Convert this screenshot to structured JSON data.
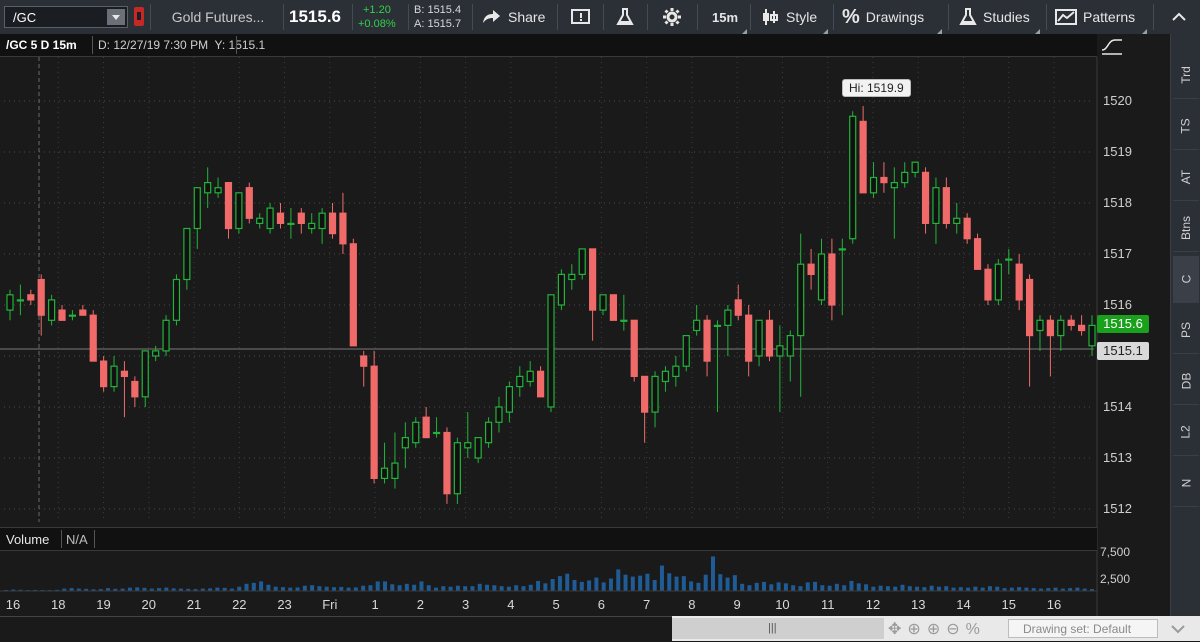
{
  "toolbar": {
    "symbol": "/GC",
    "description": "Gold Futures...",
    "last": "1515.6",
    "change": "+1.20",
    "change_pct": "+0.08%",
    "bid": "B: 1515.4",
    "ask": "A: 1515.7",
    "share_label": "Share",
    "timeframe": "15m",
    "style_label": "Style",
    "drawings_label": "Drawings",
    "studies_label": "Studies",
    "patterns_label": "Patterns"
  },
  "chart_header": {
    "symbol_period": "/GC 5 D 15m",
    "cursor_info": "D: 12/27/19 7:30 PM  Y: 1515.1"
  },
  "hi_bubble": "Hi: 1519.9",
  "price_badges": {
    "last": "1515.6",
    "cursor": "1515.1"
  },
  "volume_panel": {
    "label": "Volume",
    "value": "N/A",
    "ticks": [
      "7,500",
      "2,500"
    ]
  },
  "side_tabs": [
    "Trd",
    "TS",
    "AT",
    "Btns",
    "C",
    "PS",
    "DB",
    "L2",
    "N"
  ],
  "status": {
    "drawing_set": "Drawing set: Default"
  },
  "colors": {
    "up": "#22b33a",
    "down": "#f06a6a",
    "volume": "#1f5b94",
    "last_badge": "#1aa31a",
    "background": "#1a1a1a"
  },
  "chart_data": {
    "type": "candlestick",
    "y_ticks": [
      1512,
      1513,
      1514,
      1515,
      1516,
      1517,
      1518,
      1519,
      1520
    ],
    "ylim": [
      1511.8,
      1520.9
    ],
    "x_labels": [
      "16",
      "18",
      "19",
      "20",
      "21",
      "22",
      "23",
      "Fri",
      "1",
      "2",
      "3",
      "4",
      "5",
      "6",
      "7",
      "8",
      "9",
      "10",
      "11",
      "12",
      "13",
      "14",
      "15",
      "16"
    ],
    "candles": [
      {
        "o": 1515.9,
        "h": 1516.3,
        "l": 1515.7,
        "c": 1516.2
      },
      {
        "o": 1516.1,
        "h": 1516.4,
        "l": 1515.8,
        "c": 1516.1
      },
      {
        "o": 1516.2,
        "h": 1516.3,
        "l": 1516.0,
        "c": 1516.1
      },
      {
        "o": 1516.5,
        "h": 1516.6,
        "l": 1515.4,
        "c": 1515.8
      },
      {
        "o": 1515.7,
        "h": 1516.2,
        "l": 1515.6,
        "c": 1516.1
      },
      {
        "o": 1515.9,
        "h": 1516.0,
        "l": 1515.7,
        "c": 1515.7
      },
      {
        "o": 1515.8,
        "h": 1515.9,
        "l": 1515.7,
        "c": 1515.8
      },
      {
        "o": 1515.9,
        "h": 1516.0,
        "l": 1515.8,
        "c": 1515.8
      },
      {
        "o": 1515.8,
        "h": 1515.9,
        "l": 1514.9,
        "c": 1514.9
      },
      {
        "o": 1514.9,
        "h": 1515.0,
        "l": 1514.3,
        "c": 1514.4
      },
      {
        "o": 1514.4,
        "h": 1515.0,
        "l": 1514.3,
        "c": 1514.8
      },
      {
        "o": 1514.7,
        "h": 1514.9,
        "l": 1513.8,
        "c": 1514.6
      },
      {
        "o": 1514.5,
        "h": 1514.6,
        "l": 1514.0,
        "c": 1514.2
      },
      {
        "o": 1514.2,
        "h": 1515.1,
        "l": 1514.0,
        "c": 1515.1
      },
      {
        "o": 1515.0,
        "h": 1515.2,
        "l": 1514.9,
        "c": 1515.1
      },
      {
        "o": 1515.1,
        "h": 1515.8,
        "l": 1515.0,
        "c": 1515.7
      },
      {
        "o": 1515.7,
        "h": 1516.6,
        "l": 1515.6,
        "c": 1516.5
      },
      {
        "o": 1516.5,
        "h": 1517.5,
        "l": 1516.3,
        "c": 1517.5
      },
      {
        "o": 1517.5,
        "h": 1518.3,
        "l": 1517.1,
        "c": 1518.3
      },
      {
        "o": 1518.2,
        "h": 1518.7,
        "l": 1517.9,
        "c": 1518.4
      },
      {
        "o": 1518.2,
        "h": 1518.5,
        "l": 1518.1,
        "c": 1518.3
      },
      {
        "o": 1518.4,
        "h": 1518.4,
        "l": 1517.3,
        "c": 1517.5
      },
      {
        "o": 1517.5,
        "h": 1518.2,
        "l": 1517.4,
        "c": 1518.2
      },
      {
        "o": 1518.3,
        "h": 1518.4,
        "l": 1517.6,
        "c": 1517.7
      },
      {
        "o": 1517.6,
        "h": 1517.8,
        "l": 1517.5,
        "c": 1517.7
      },
      {
        "o": 1517.5,
        "h": 1518.0,
        "l": 1517.4,
        "c": 1517.9
      },
      {
        "o": 1517.8,
        "h": 1518.0,
        "l": 1517.5,
        "c": 1517.6
      },
      {
        "o": 1517.6,
        "h": 1517.9,
        "l": 1517.3,
        "c": 1517.6
      },
      {
        "o": 1517.8,
        "h": 1517.9,
        "l": 1517.4,
        "c": 1517.6
      },
      {
        "o": 1517.5,
        "h": 1517.8,
        "l": 1517.4,
        "c": 1517.6
      },
      {
        "o": 1517.5,
        "h": 1517.9,
        "l": 1517.2,
        "c": 1517.8
      },
      {
        "o": 1517.8,
        "h": 1518.0,
        "l": 1517.3,
        "c": 1517.4
      },
      {
        "o": 1517.8,
        "h": 1518.2,
        "l": 1517.0,
        "c": 1517.2
      },
      {
        "o": 1517.2,
        "h": 1517.3,
        "l": 1515.2,
        "c": 1515.2
      },
      {
        "o": 1515.0,
        "h": 1515.1,
        "l": 1514.4,
        "c": 1514.8
      },
      {
        "o": 1514.8,
        "h": 1515.1,
        "l": 1512.5,
        "c": 1512.6
      },
      {
        "o": 1512.6,
        "h": 1513.3,
        "l": 1512.5,
        "c": 1512.8
      },
      {
        "o": 1512.6,
        "h": 1513.5,
        "l": 1512.4,
        "c": 1512.9
      },
      {
        "o": 1513.2,
        "h": 1513.7,
        "l": 1512.8,
        "c": 1513.4
      },
      {
        "o": 1513.3,
        "h": 1513.8,
        "l": 1513.2,
        "c": 1513.7
      },
      {
        "o": 1513.8,
        "h": 1514.0,
        "l": 1513.6,
        "c": 1513.4
      },
      {
        "o": 1513.5,
        "h": 1513.8,
        "l": 1513.4,
        "c": 1513.5
      },
      {
        "o": 1513.5,
        "h": 1513.6,
        "l": 1512.1,
        "c": 1512.3
      },
      {
        "o": 1512.3,
        "h": 1513.4,
        "l": 1512.1,
        "c": 1513.3
      },
      {
        "o": 1513.2,
        "h": 1513.9,
        "l": 1513.0,
        "c": 1513.3
      },
      {
        "o": 1513.0,
        "h": 1513.4,
        "l": 1512.9,
        "c": 1513.4
      },
      {
        "o": 1513.3,
        "h": 1513.8,
        "l": 1513.2,
        "c": 1513.7
      },
      {
        "o": 1513.7,
        "h": 1514.2,
        "l": 1513.5,
        "c": 1514.0
      },
      {
        "o": 1513.9,
        "h": 1514.5,
        "l": 1513.7,
        "c": 1514.4
      },
      {
        "o": 1514.4,
        "h": 1514.8,
        "l": 1514.2,
        "c": 1514.6
      },
      {
        "o": 1514.5,
        "h": 1514.9,
        "l": 1514.4,
        "c": 1514.7
      },
      {
        "o": 1514.7,
        "h": 1514.8,
        "l": 1514.2,
        "c": 1514.2
      },
      {
        "o": 1514.0,
        "h": 1516.2,
        "l": 1513.9,
        "c": 1516.2
      },
      {
        "o": 1516.0,
        "h": 1516.7,
        "l": 1515.9,
        "c": 1516.6
      },
      {
        "o": 1516.5,
        "h": 1516.8,
        "l": 1516.3,
        "c": 1516.6
      },
      {
        "o": 1516.6,
        "h": 1517.1,
        "l": 1516.5,
        "c": 1517.1
      },
      {
        "o": 1517.1,
        "h": 1517.1,
        "l": 1515.3,
        "c": 1515.9
      },
      {
        "o": 1515.9,
        "h": 1516.2,
        "l": 1515.8,
        "c": 1516.2
      },
      {
        "o": 1516.2,
        "h": 1516.2,
        "l": 1515.7,
        "c": 1515.7
      },
      {
        "o": 1515.7,
        "h": 1516.2,
        "l": 1515.5,
        "c": 1515.7
      },
      {
        "o": 1515.7,
        "h": 1515.7,
        "l": 1514.5,
        "c": 1514.6
      },
      {
        "o": 1514.6,
        "h": 1514.6,
        "l": 1513.3,
        "c": 1513.9
      },
      {
        "o": 1513.9,
        "h": 1514.7,
        "l": 1513.6,
        "c": 1514.6
      },
      {
        "o": 1514.5,
        "h": 1514.8,
        "l": 1514.3,
        "c": 1514.7
      },
      {
        "o": 1514.6,
        "h": 1515.0,
        "l": 1514.4,
        "c": 1514.8
      },
      {
        "o": 1514.8,
        "h": 1515.4,
        "l": 1514.7,
        "c": 1515.4
      },
      {
        "o": 1515.5,
        "h": 1516.0,
        "l": 1515.4,
        "c": 1515.7
      },
      {
        "o": 1515.7,
        "h": 1515.8,
        "l": 1514.6,
        "c": 1514.9
      },
      {
        "o": 1515.6,
        "h": 1515.7,
        "l": 1513.9,
        "c": 1515.6
      },
      {
        "o": 1515.6,
        "h": 1516.0,
        "l": 1515.0,
        "c": 1515.9
      },
      {
        "o": 1516.1,
        "h": 1516.4,
        "l": 1515.7,
        "c": 1515.8
      },
      {
        "o": 1515.8,
        "h": 1516.0,
        "l": 1514.6,
        "c": 1514.9
      },
      {
        "o": 1515.0,
        "h": 1515.6,
        "l": 1514.8,
        "c": 1515.7
      },
      {
        "o": 1515.7,
        "h": 1515.9,
        "l": 1514.9,
        "c": 1515.0
      },
      {
        "o": 1515.0,
        "h": 1515.6,
        "l": 1513.9,
        "c": 1515.2
      },
      {
        "o": 1515.0,
        "h": 1515.5,
        "l": 1514.5,
        "c": 1515.4
      },
      {
        "o": 1515.4,
        "h": 1517.4,
        "l": 1514.2,
        "c": 1516.8
      },
      {
        "o": 1516.8,
        "h": 1517.1,
        "l": 1516.3,
        "c": 1516.6
      },
      {
        "o": 1516.1,
        "h": 1517.3,
        "l": 1516.0,
        "c": 1517.0
      },
      {
        "o": 1517.0,
        "h": 1517.3,
        "l": 1515.7,
        "c": 1516.0
      },
      {
        "o": 1517.1,
        "h": 1517.3,
        "l": 1515.8,
        "c": 1517.1
      },
      {
        "o": 1517.3,
        "h": 1519.8,
        "l": 1517.2,
        "c": 1519.7
      },
      {
        "o": 1519.6,
        "h": 1519.9,
        "l": 1518.2,
        "c": 1518.2
      },
      {
        "o": 1518.2,
        "h": 1518.8,
        "l": 1518.1,
        "c": 1518.5
      },
      {
        "o": 1518.5,
        "h": 1518.8,
        "l": 1518.2,
        "c": 1518.4
      },
      {
        "o": 1518.3,
        "h": 1518.7,
        "l": 1517.3,
        "c": 1518.4
      },
      {
        "o": 1518.4,
        "h": 1518.8,
        "l": 1518.3,
        "c": 1518.6
      },
      {
        "o": 1518.6,
        "h": 1518.8,
        "l": 1518.5,
        "c": 1518.8
      },
      {
        "o": 1518.6,
        "h": 1518.7,
        "l": 1517.4,
        "c": 1517.6
      },
      {
        "o": 1517.6,
        "h": 1518.5,
        "l": 1517.2,
        "c": 1518.3
      },
      {
        "o": 1518.3,
        "h": 1518.5,
        "l": 1517.5,
        "c": 1517.6
      },
      {
        "o": 1517.6,
        "h": 1518.0,
        "l": 1517.4,
        "c": 1517.7
      },
      {
        "o": 1517.7,
        "h": 1517.8,
        "l": 1517.2,
        "c": 1517.3
      },
      {
        "o": 1517.3,
        "h": 1517.4,
        "l": 1516.7,
        "c": 1516.7
      },
      {
        "o": 1516.7,
        "h": 1516.8,
        "l": 1516.0,
        "c": 1516.1
      },
      {
        "o": 1516.1,
        "h": 1516.9,
        "l": 1516.0,
        "c": 1516.8
      },
      {
        "o": 1516.9,
        "h": 1517.1,
        "l": 1516.6,
        "c": 1516.9
      },
      {
        "o": 1516.8,
        "h": 1517.0,
        "l": 1515.9,
        "c": 1516.1
      },
      {
        "o": 1516.5,
        "h": 1516.6,
        "l": 1514.4,
        "c": 1515.4
      },
      {
        "o": 1515.5,
        "h": 1515.8,
        "l": 1515.1,
        "c": 1515.7
      },
      {
        "o": 1515.7,
        "h": 1515.8,
        "l": 1514.6,
        "c": 1515.4
      },
      {
        "o": 1515.4,
        "h": 1515.8,
        "l": 1515.1,
        "c": 1515.7
      },
      {
        "o": 1515.7,
        "h": 1515.8,
        "l": 1515.5,
        "c": 1515.6
      },
      {
        "o": 1515.6,
        "h": 1515.8,
        "l": 1515.4,
        "c": 1515.5
      },
      {
        "o": 1515.2,
        "h": 1515.8,
        "l": 1515.0,
        "c": 1515.6
      }
    ],
    "volume": [
      200,
      300,
      250,
      180,
      220,
      200,
      180,
      240,
      500,
      600,
      500,
      450,
      350,
      400,
      600,
      450,
      500,
      700,
      750,
      650,
      500,
      600,
      700,
      550,
      500,
      450,
      400,
      500,
      550,
      700,
      650,
      500,
      900,
      1500,
      1700,
      2000,
      1300,
      900,
      800,
      700,
      750,
      1100,
      1200,
      1000,
      900,
      800,
      850,
      700,
      750,
      1100,
      1200,
      2000,
      2000,
      1400,
      1200,
      1500,
      1300,
      2000,
      1200,
      700,
      1000,
      900,
      1100,
      1000,
      1000,
      1500,
      1300,
      1200,
      1000,
      900,
      1200,
      1000,
      1300,
      2100,
      1600,
      2500,
      3100,
      3600,
      2300,
      1900,
      2200,
      2800,
      1800,
      2600,
      4500,
      3400,
      3000,
      3200,
      3600,
      2300,
      5300,
      3700,
      3000,
      3100,
      2000,
      1700,
      3400,
      7200,
      3500,
      2800,
      3300,
      1500,
      1200,
      1700,
      1900,
      1400,
      1800,
      1600,
      1200,
      1000,
      1800,
      1900,
      1200,
      1100,
      1500,
      1200,
      2100,
      1600,
      1400,
      900,
      1100,
      1000,
      900,
      1300,
      1000,
      900,
      800,
      1100,
      900,
      1000,
      700,
      800,
      700,
      900,
      700,
      1000,
      900,
      600,
      700,
      800,
      700,
      600,
      500,
      600,
      700,
      500,
      600,
      700,
      500,
      400
    ]
  }
}
